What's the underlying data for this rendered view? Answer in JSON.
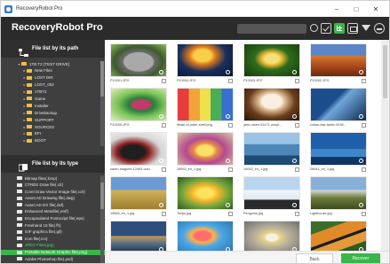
{
  "window": {
    "title": "RecoveryRobot Pro",
    "controls": [
      "–",
      "□",
      "✕"
    ]
  },
  "app": {
    "title": "RecoveryRobot Pro"
  },
  "toolbar": {
    "icons": [
      "search-icon",
      "check-icon",
      "grid-icon",
      "preview-icon",
      "filter-icon",
      "minus-icon"
    ],
    "active": "grid-icon"
  },
  "sidebar": {
    "path_header": "File list by its path",
    "type_header": "File list by its type",
    "path_tree": [
      {
        "label": "1TB T2 (TEST DRIVE)",
        "level": 0,
        "exp": "▾"
      },
      {
        "label": "New Files",
        "level": 1,
        "exp": "▸"
      },
      {
        "label": "LOST DIR",
        "level": 1,
        "exp": "▸"
      },
      {
        "label": "LOST_002",
        "level": 1,
        "exp": "▸"
      },
      {
        "label": "1TBT2",
        "level": 1,
        "exp": "▸"
      },
      {
        "label": "Game",
        "level": 1,
        "exp": "▸"
      },
      {
        "label": "Installer",
        "level": 1,
        "exp": "▸"
      },
      {
        "label": "Drivebackup",
        "level": 1,
        "exp": "▸"
      },
      {
        "label": "SUPPORT",
        "level": 1,
        "exp": "▸"
      },
      {
        "label": "SOURCES",
        "level": 1,
        "exp": "▸"
      },
      {
        "label": "EFI",
        "level": 1,
        "exp": "▸"
      },
      {
        "label": "BOOT",
        "level": 1,
        "exp": "▸"
      }
    ],
    "type_tree": [
      {
        "label": "Bitmap files(.bmp)",
        "state": ""
      },
      {
        "label": "CTREE Draw file(.ctr)",
        "state": ""
      },
      {
        "label": "Corel Draw Vector Image file(.cdr)",
        "state": ""
      },
      {
        "label": "AutoCAD Drawing file(.dwg)",
        "state": ""
      },
      {
        "label": "AutoCAD DX file(.dxf)",
        "state": ""
      },
      {
        "label": "Enhanced Metafile(.emf)",
        "state": ""
      },
      {
        "label": "Encapsulated Postscript file(.eps)",
        "state": ""
      },
      {
        "label": "Freehand 10 file(.fh)",
        "state": ""
      },
      {
        "label": "GIF graphics file(.gif)",
        "state": ""
      },
      {
        "label": "Icon file(.ico)",
        "state": ""
      },
      {
        "label": "JPEG Files(.jpg)",
        "state": "sel"
      },
      {
        "label": "Portable Network Graphic file(.png)",
        "state": "hl"
      },
      {
        "label": "Adobe Photoshop file(.psd)",
        "state": ""
      }
    ]
  },
  "grid": {
    "tiles": [
      {
        "name": "P10001.JPG",
        "img": "img-koala"
      },
      {
        "name": "P10004.JPG",
        "img": "img-jelly"
      },
      {
        "name": "P10003.JPG",
        "img": "img-tulip"
      },
      {
        "name": "P10002.JPG",
        "img": "img-desert"
      },
      {
        "name": "P10005.JPG",
        "img": "img-hydra"
      },
      {
        "name": "detail-of-outer-shell.png",
        "img": "img-colorful"
      },
      {
        "name": "jane-rosen-91471-unspl...",
        "img": "img-cake"
      },
      {
        "name": "zoltan-tasi-fabric-0038...",
        "img": "img-wing"
      },
      {
        "name": "karen-maguire-12463-unsl...",
        "img": "img-moto"
      },
      {
        "name": "18992_en_1.jpg",
        "img": "img-flower"
      },
      {
        "name": "19092_en_1.jpg",
        "img": "img-dolphin"
      },
      {
        "name": "26941_en_1.jpg",
        "img": "img-ocean"
      },
      {
        "name": "19665_en_1.jpg",
        "img": "img-field"
      },
      {
        "name": "Tulips.jpg",
        "img": "img-yellow"
      },
      {
        "name": "Penguins.jpg",
        "img": "img-penguin"
      },
      {
        "name": "Lighthouse.jpg",
        "img": "img-light"
      },
      {
        "name": "",
        "img": "img-lake"
      },
      {
        "name": "",
        "img": "img-balloon"
      },
      {
        "name": "",
        "img": "img-chrys"
      },
      {
        "name": "",
        "img": "img-tiger"
      }
    ]
  },
  "footer": {
    "back_label": "Back",
    "recover_label": "Recover"
  },
  "colors": {
    "accent": "#3ab54a",
    "header_bg": "#2b2b2b",
    "sidebar_bg": "#3f3f3f"
  }
}
